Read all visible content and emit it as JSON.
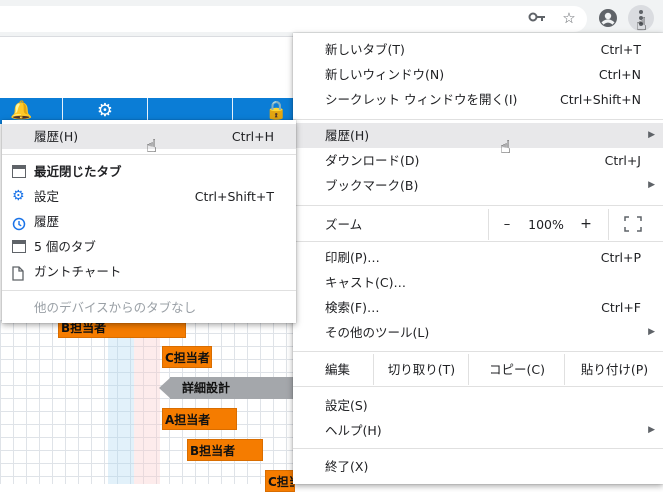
{
  "toolbar": {
    "key_icon": "key-icon",
    "star_icon": "star-icon",
    "profile_icon": "account-circle-icon",
    "menu_icon": "three-dots-vertical-icon"
  },
  "page": {
    "tasks": [
      {
        "label": "B担当者"
      },
      {
        "label": "C担当者"
      },
      {
        "label": "詳細設計"
      },
      {
        "label": "A担当者"
      },
      {
        "label": "B担当者"
      },
      {
        "label": "C担当者"
      }
    ]
  },
  "main_menu": {
    "new_tab": {
      "label": "新しいタブ(T)",
      "shortcut": "Ctrl+T"
    },
    "new_window": {
      "label": "新しいウィンドウ(N)",
      "shortcut": "Ctrl+N"
    },
    "incognito": {
      "label": "シークレット ウィンドウを開く(I)",
      "shortcut": "Ctrl+Shift+N"
    },
    "history": {
      "label": "履歴(H)"
    },
    "downloads": {
      "label": "ダウンロード(D)",
      "shortcut": "Ctrl+J"
    },
    "bookmarks": {
      "label": "ブックマーク(B)"
    },
    "zoom": {
      "label": "ズーム",
      "minus": "–",
      "value": "100%",
      "plus": "+"
    },
    "print": {
      "label": "印刷(P)…",
      "shortcut": "Ctrl+P"
    },
    "cast": {
      "label": "キャスト(C)…"
    },
    "find": {
      "label": "検索(F)…",
      "shortcut": "Ctrl+F"
    },
    "more_tools": {
      "label": "その他のツール(L)"
    },
    "edit": {
      "label": "編集",
      "cut": "切り取り(T)",
      "copy": "コピー(C)",
      "paste": "貼り付け(P)"
    },
    "settings": {
      "label": "設定(S)"
    },
    "help": {
      "label": "ヘルプ(H)"
    },
    "exit": {
      "label": "終了(X)"
    }
  },
  "history_menu": {
    "history": {
      "label": "履歴(H)",
      "shortcut": "Ctrl+H"
    },
    "recently_closed": {
      "label": "最近閉じたタブ"
    },
    "settings": {
      "label": "設定",
      "shortcut": "Ctrl+Shift+T"
    },
    "history_entry": {
      "label": "履歴"
    },
    "five_tabs": {
      "label": "5 個のタブ"
    },
    "gantt_chart": {
      "label": "ガントチャート"
    },
    "no_other_devices": {
      "label": "他のデバイスからのタブなし"
    }
  }
}
